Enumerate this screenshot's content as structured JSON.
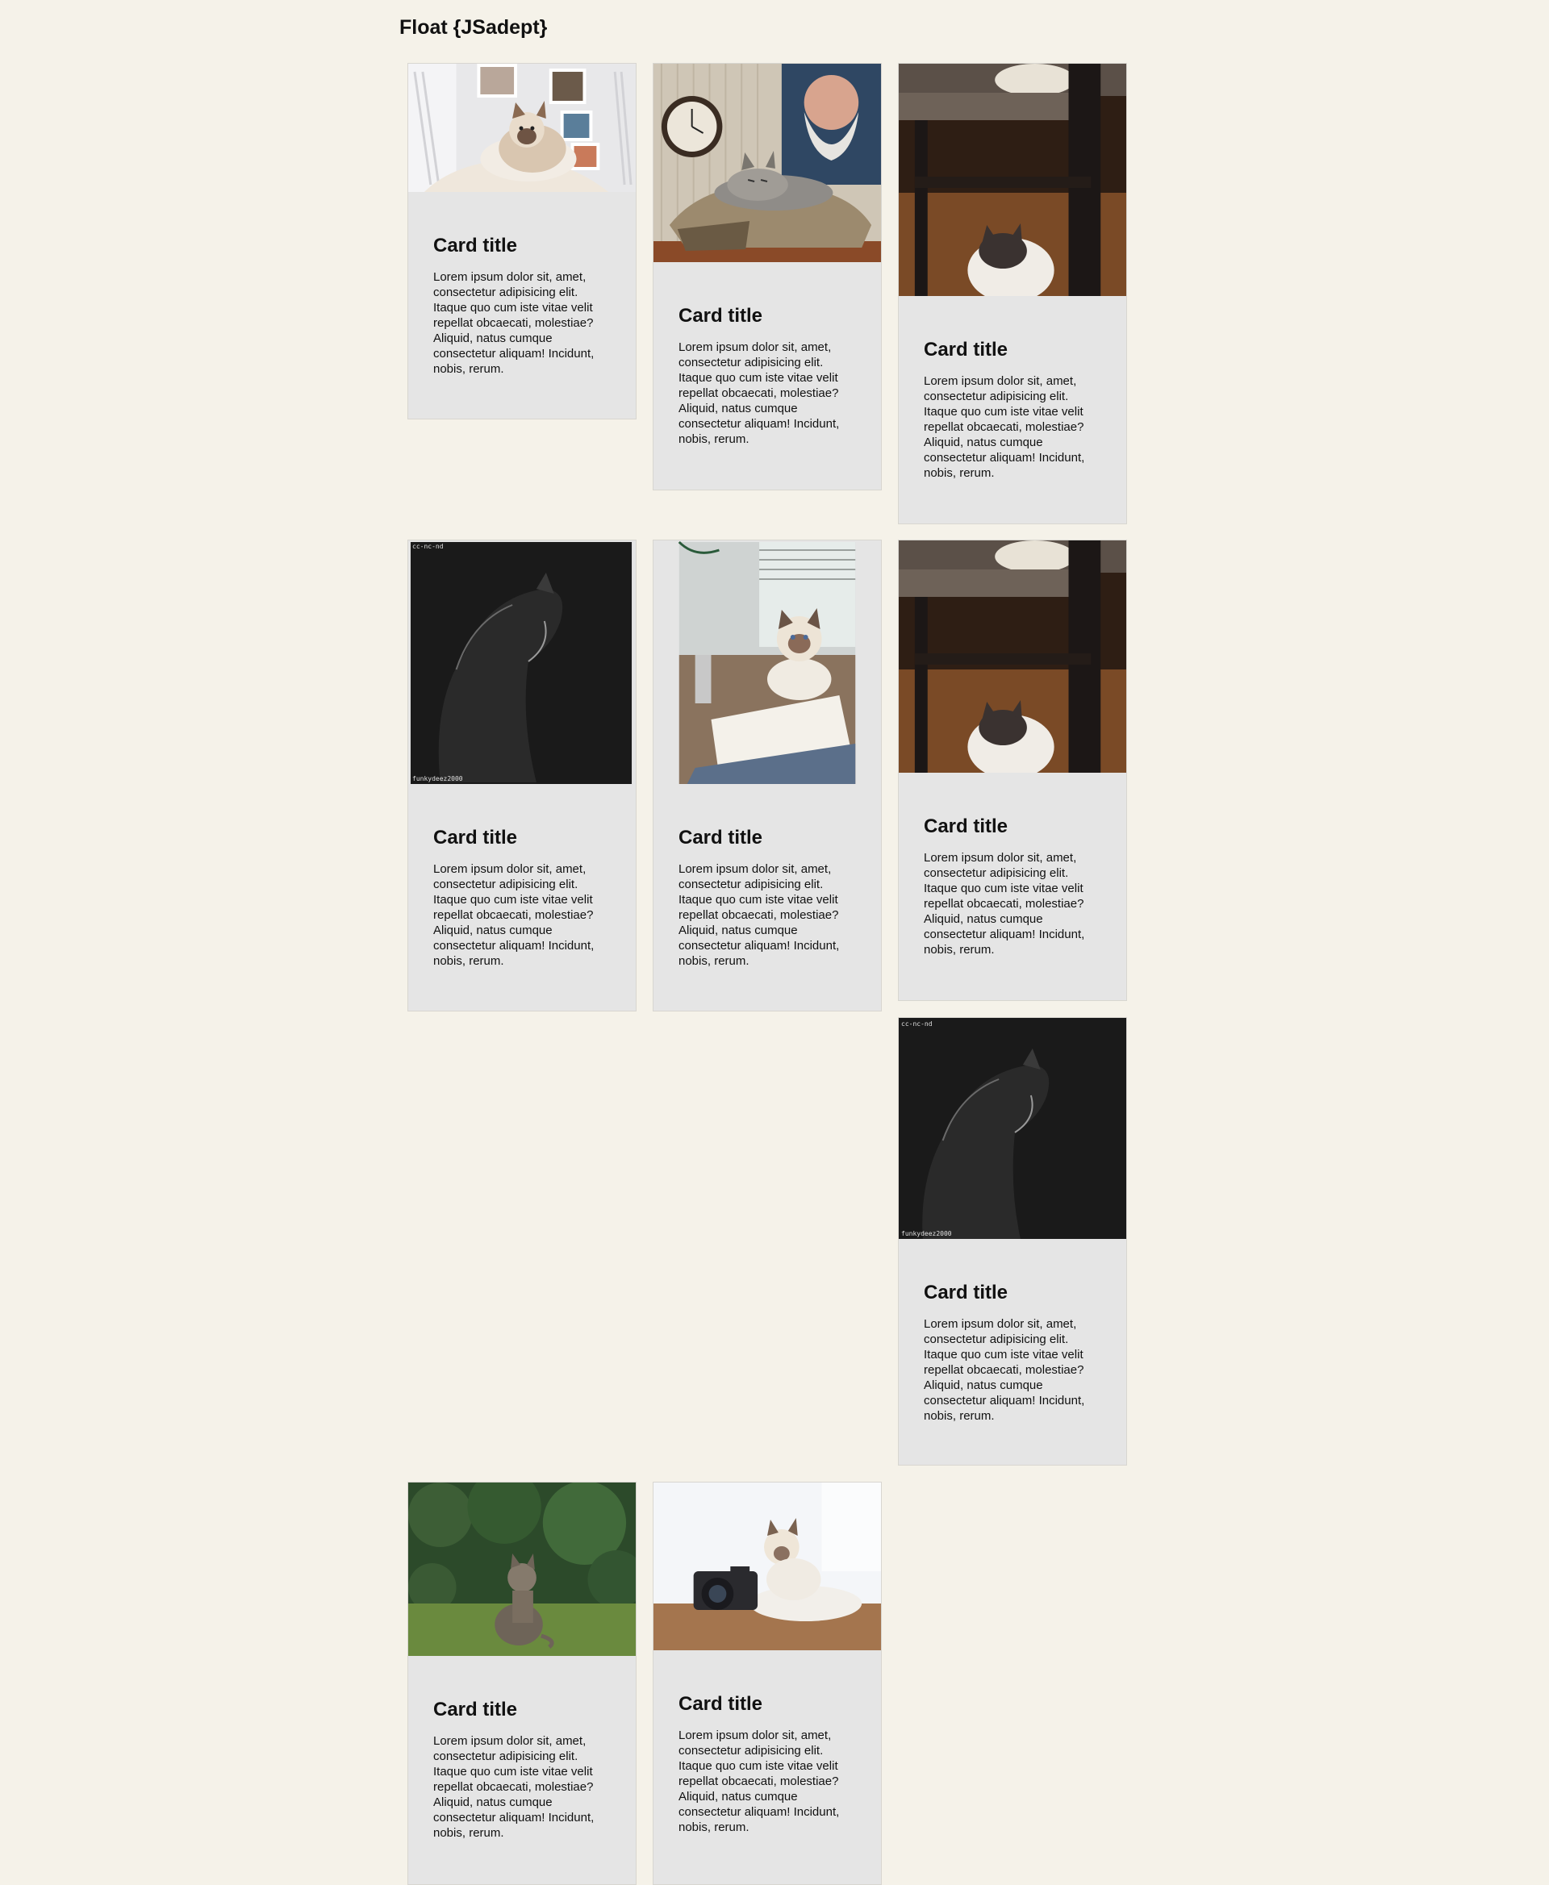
{
  "page": {
    "title": "Float {JSadept}"
  },
  "cards": [
    {
      "title": "Card title",
      "text": "Lorem ipsum dolor sit, amet, consectetur adipisicing elit. Itaque quo cum iste vitae velit repellat obcaecati, molestiae? Aliquid, natus cumque consectetur aliquam! Incidunt, nobis, rerum.",
      "image": "cat-on-blanket-photo"
    },
    {
      "title": "Card title",
      "text": "Lorem ipsum dolor sit, amet, consectetur adipisicing elit. Itaque quo cum iste vitae velit repellat obcaecati, molestiae? Aliquid, natus cumque consectetur aliquam! Incidunt, nobis, rerum.",
      "image": "cat-in-bag-with-clock-photo"
    },
    {
      "title": "Card title",
      "text": "Lorem ipsum dolor sit, amet, consectetur adipisicing elit. Itaque quo cum iste vitae velit repellat obcaecati, molestiae? Aliquid, natus cumque consectetur aliquam! Incidunt, nobis, rerum.",
      "image": "cats-under-chair-photo"
    },
    {
      "title": "Card title",
      "text": "Lorem ipsum dolor sit, amet, consectetur adipisicing elit. Itaque quo cum iste vitae velit repellat obcaecati, molestiae? Aliquid, natus cumque consectetur aliquam! Incidunt, nobis, rerum.",
      "image": "dark-cat-silhouette-photo",
      "credit_top": "cc-nc-nd",
      "credit_bottom": "funkydeez2000"
    },
    {
      "title": "Card title",
      "text": "Lorem ipsum dolor sit, amet, consectetur adipisicing elit. Itaque quo cum iste vitae velit repellat obcaecati, molestiae? Aliquid, natus cumque consectetur aliquam! Incidunt, nobis, rerum.",
      "image": "cat-on-desk-photo"
    },
    {
      "title": "Card title",
      "text": "Lorem ipsum dolor sit, amet, consectetur adipisicing elit. Itaque quo cum iste vitae velit repellat obcaecati, molestiae? Aliquid, natus cumque consectetur aliquam! Incidunt, nobis, rerum.",
      "image": "cats-under-chair-photo"
    },
    {
      "title": "Card title",
      "text": "Lorem ipsum dolor sit, amet, consectetur adipisicing elit. Itaque quo cum iste vitae velit repellat obcaecati, molestiae? Aliquid, natus cumque consectetur aliquam! Incidunt, nobis, rerum.",
      "image": "dark-cat-silhouette-photo",
      "credit_top": "cc-nc-nd",
      "credit_bottom": "funkydeez2000"
    },
    {
      "title": "Card title",
      "text": "Lorem ipsum dolor sit, amet, consectetur adipisicing elit. Itaque quo cum iste vitae velit repellat obcaecati, molestiae? Aliquid, natus cumque consectetur aliquam! Incidunt, nobis, rerum.",
      "image": "kitten-in-grass-photo"
    },
    {
      "title": "Card title",
      "text": "Lorem ipsum dolor sit, amet, consectetur adipisicing elit. Itaque quo cum iste vitae velit repellat obcaecati, molestiae? Aliquid, natus cumque consectetur aliquam! Incidunt, nobis, rerum.",
      "image": "cat-with-camera-photo"
    }
  ],
  "colors": {
    "page_background": "#f5f2e9",
    "card_background": "#e5e5e5",
    "text": "#111111"
  }
}
